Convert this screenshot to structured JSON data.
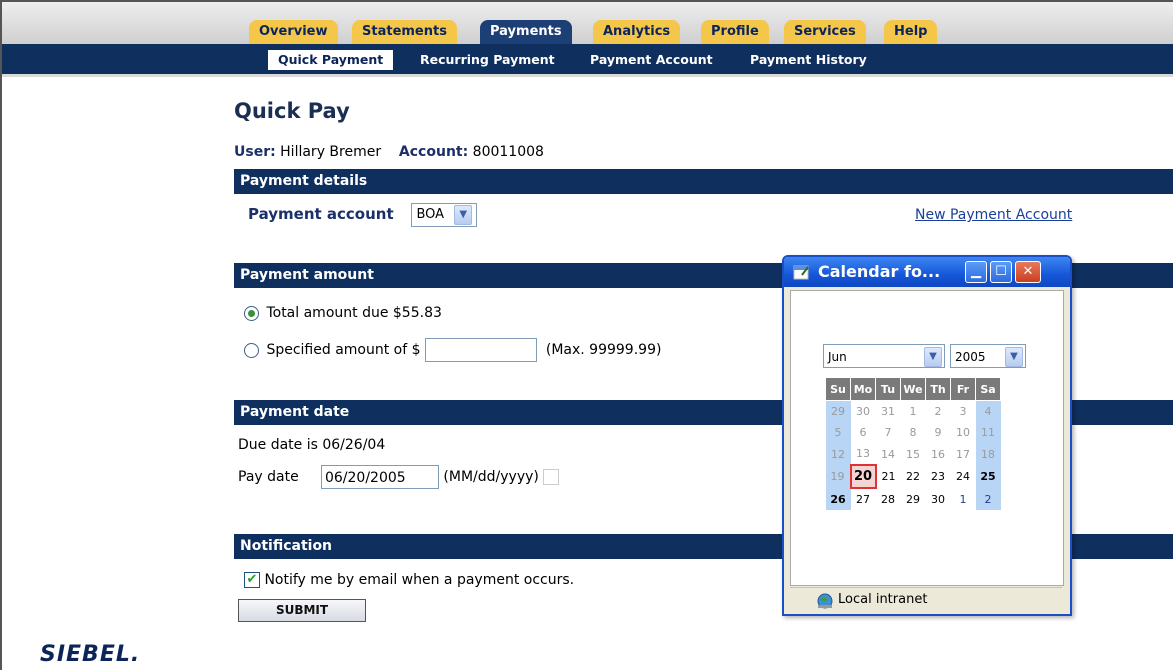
{
  "nav": {
    "tabs": [
      "Overview",
      "Statements",
      "Payments",
      "Analytics",
      "Profile",
      "Services",
      "Help"
    ],
    "active_tab": "Payments",
    "subtabs": [
      "Quick Payment",
      "Recurring Payment",
      "Payment Account",
      "Payment History"
    ],
    "active_subtab": "Quick Payment"
  },
  "page": {
    "title": "Quick Pay",
    "user_label": "User:",
    "user_value": "Hillary Bremer",
    "account_label": "Account:",
    "account_value": "80011008"
  },
  "payment_details": {
    "header": "Payment details",
    "account_label": "Payment account",
    "account_selected": "BOA",
    "new_account_link": "New Payment Account"
  },
  "payment_amount": {
    "header": "Payment amount",
    "total_option": "Total amount due $55.83",
    "specified_option": "Specified amount of $",
    "specified_value": "",
    "max_hint": "(Max. 99999.99)"
  },
  "payment_date": {
    "header": "Payment date",
    "due_text": "Due date is 06/26/04",
    "pay_label": "Pay date",
    "pay_value": "06/20/2005",
    "format_hint": "(MM/dd/yyyy)"
  },
  "notification": {
    "header": "Notification",
    "email_option": "Notify me by email when a payment occurs.",
    "email_checked": true,
    "check_glyph": "✔"
  },
  "submit_label": "SUBMIT",
  "logo_text": "SIEBEL.",
  "calendar_window": {
    "title": "Calendar fo...",
    "month": "Jun",
    "year": "2005",
    "weekday_headers": [
      "Su",
      "Mo",
      "Tu",
      "We",
      "Th",
      "Fr",
      "Sa"
    ],
    "weeks": [
      [
        "29",
        "30",
        "31",
        "1",
        "2",
        "3",
        "4"
      ],
      [
        "5",
        "6",
        "7",
        "8",
        "9",
        "10",
        "11"
      ],
      [
        "12",
        "13",
        "14",
        "15",
        "16",
        "17",
        "18"
      ],
      [
        "19",
        "20",
        "21",
        "22",
        "23",
        "24",
        "25"
      ],
      [
        "26",
        "27",
        "28",
        "29",
        "30",
        "1",
        "2"
      ]
    ],
    "selected_day": "20",
    "status_zone": "Local intranet",
    "icons": [
      "calendar-app-icon",
      "minimize-icon",
      "maximize-icon",
      "close-icon",
      "globe-icon",
      "dropdown-arrow-icon"
    ],
    "colors": {
      "title_bar": "#1556d8",
      "weekend": "#b9d5f5",
      "selected_border": "#dd3333"
    }
  },
  "colors": {
    "nav_dark": "#0f2f5f",
    "tab_gold": "#f4c64a",
    "label_blue": "#1b2f6a"
  }
}
